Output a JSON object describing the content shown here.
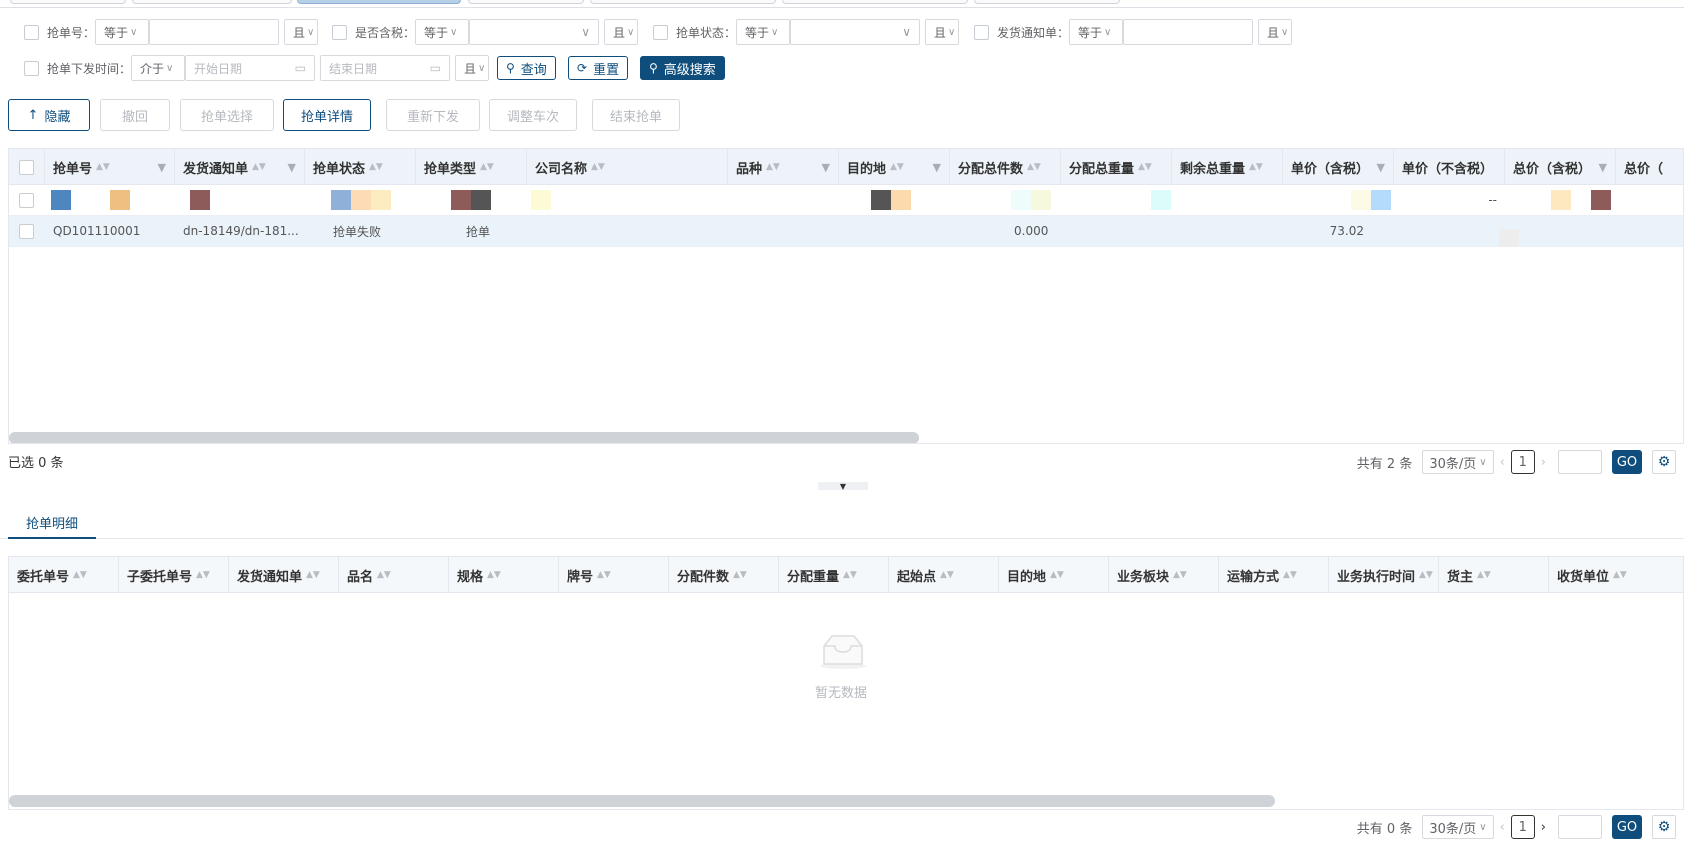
{
  "filters": {
    "row1": [
      {
        "label": "抢单号：",
        "op": "等于",
        "value": "",
        "logic": "且"
      },
      {
        "label": "是否含税：",
        "op": "等于",
        "value": "",
        "logic": "且"
      },
      {
        "label": "抢单状态：",
        "op": "等于",
        "value": "",
        "logic": "且"
      },
      {
        "label": "发货通知单：",
        "op": "等于",
        "value": "",
        "logic": "且"
      }
    ],
    "row2": {
      "label": "抢单下发时间：",
      "op": "介于",
      "start_placeholder": "开始日期",
      "end_placeholder": "结束日期",
      "logic": "且"
    },
    "query_label": "查询",
    "reset_label": "重置",
    "advanced_label": "高级搜索"
  },
  "toolbar": {
    "hide_label": "隐藏",
    "withdraw_label": "撤回",
    "select_label": "抢单选择",
    "detail_label": "抢单详情",
    "reissue_label": "重新下发",
    "adjust_label": "调整车次",
    "end_label": "结束抢单"
  },
  "main_table": {
    "columns": [
      "抢单号",
      "发货通知单",
      "抢单状态",
      "抢单类型",
      "公司名称",
      "品种",
      "目的地",
      "分配总件数",
      "分配总重量",
      "剩余总重量",
      "单价（含税）",
      "单价（不含税）",
      "总价（含税）",
      "总价（"
    ],
    "rows": [
      {
        "cells": [
          "",
          "",
          "",
          "",
          "",
          "",
          "",
          "",
          "",
          "",
          "",
          "--",
          "",
          ""
        ]
      },
      {
        "cells": [
          "QD101110001",
          "dn-18149/dn-181...",
          "抢单失败",
          "抢单",
          "",
          "",
          "",
          "0.000",
          "",
          "",
          "73.02",
          "",
          "",
          ""
        ]
      }
    ],
    "selected_text": "已选 0 条",
    "total_text": "共有 2 条",
    "page_size": "30条/页",
    "page": "1",
    "go_label": "GO"
  },
  "detail_tab": {
    "label": "抢单明细"
  },
  "detail_table": {
    "columns": [
      "委托单号",
      "子委托单号",
      "发货通知单",
      "品名",
      "规格",
      "牌号",
      "分配件数",
      "分配重量",
      "起始点",
      "目的地",
      "业务板块",
      "运输方式",
      "业务执行时间",
      "货主",
      "收货单位"
    ],
    "empty_text": "暂无数据",
    "total_text": "共有 0 条",
    "page_size": "30条/页",
    "page": "1",
    "go_label": "GO"
  },
  "colors": {
    "accent": "#0e4d7c",
    "header_bg": "#edf3f8",
    "selected_row_bg": "#eaf3fa"
  }
}
